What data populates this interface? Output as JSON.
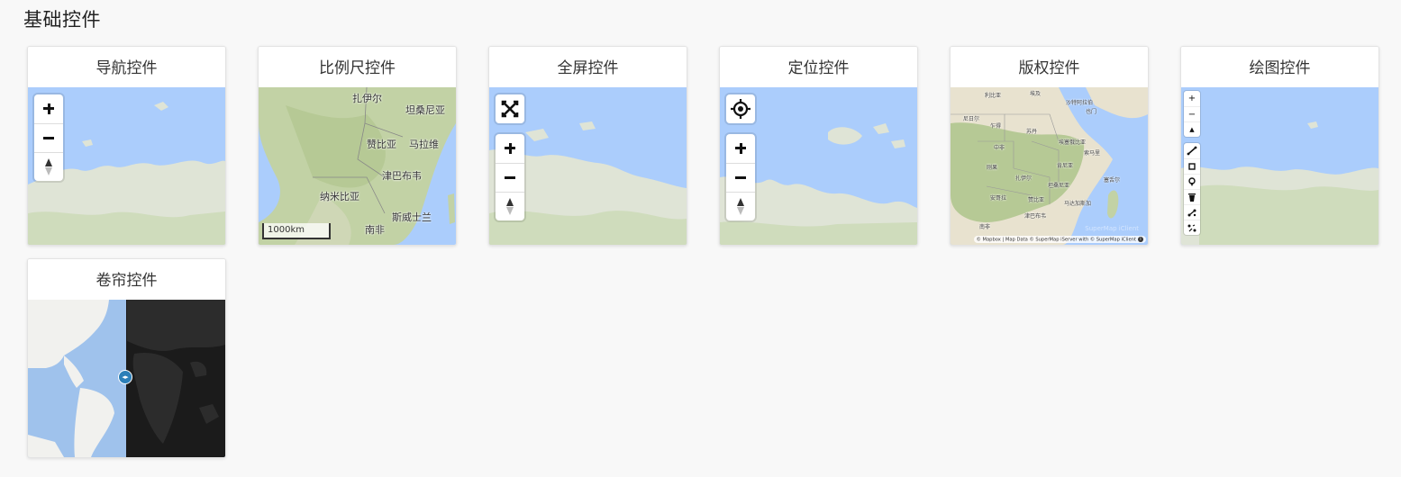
{
  "page": {
    "title": "基础控件"
  },
  "cards": [
    {
      "title": "导航控件"
    },
    {
      "title": "比例尺控件"
    },
    {
      "title": "全屏控件"
    },
    {
      "title": "定位控件"
    },
    {
      "title": "版权控件"
    },
    {
      "title": "绘图控件"
    },
    {
      "title": "卷帘控件"
    }
  ],
  "scale_map": {
    "labels": [
      "扎伊尔",
      "坦桑尼亚",
      "赞比亚",
      "马拉维",
      "津巴布韦",
      "纳米比亚",
      "斯威士兰",
      "南非"
    ],
    "scale_text": "1000km"
  },
  "copyright_map": {
    "labels": [
      "利比亚",
      "埃及",
      "沙特阿拉伯",
      "也门",
      "尼日尔",
      "乍得",
      "苏丹",
      "埃塞俄比亚",
      "索马里",
      "中非",
      "刚果",
      "肯尼亚",
      "扎伊尔",
      "坦桑尼亚",
      "安哥拉",
      "赞比亚",
      "马达加斯加",
      "津巴布韦",
      "南非",
      "塞舌尔"
    ],
    "attribution": "© Mapbox | Map Data © SuperMap iServer with © SuperMap iClient",
    "watermark": "SuperMap iClient"
  },
  "colors": {
    "ocean": "#abcdfc",
    "land": "#dfe5d6",
    "land_green": "#c6dab0",
    "dark_bg": "#1b1b1b",
    "swipe_handle": "#2c7fb8"
  },
  "icons": {
    "zoom_in": "plus-icon",
    "zoom_out": "minus-icon",
    "compass": "compass-icon",
    "fullscreen": "fullscreen-icon",
    "geolocate": "crosshair-icon"
  }
}
